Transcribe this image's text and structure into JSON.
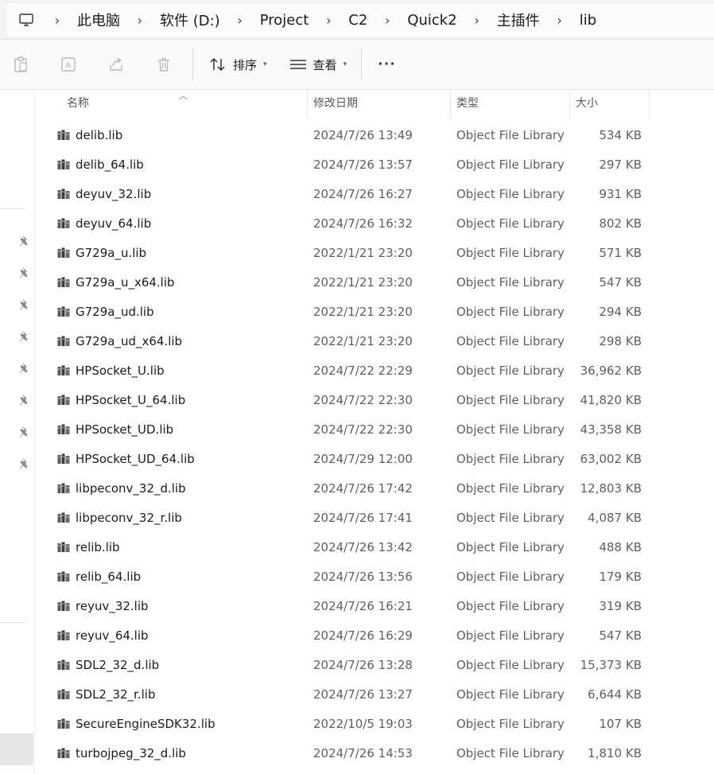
{
  "breadcrumb": {
    "items": [
      "此电脑",
      "软件 (D:)",
      "Project",
      "C2",
      "Quick2",
      "主插件",
      "lib"
    ]
  },
  "toolbar": {
    "sort_label": "排序",
    "view_label": "查看",
    "more_label": "···"
  },
  "columns": {
    "name": "名称",
    "date": "修改日期",
    "type": "类型",
    "size": "大小"
  },
  "files": [
    {
      "name": "delib.lib",
      "date": "2024/7/26 13:49",
      "type": "Object File Library",
      "size": "534 KB"
    },
    {
      "name": "delib_64.lib",
      "date": "2024/7/26 13:57",
      "type": "Object File Library",
      "size": "297 KB"
    },
    {
      "name": "deyuv_32.lib",
      "date": "2024/7/26 16:27",
      "type": "Object File Library",
      "size": "931 KB"
    },
    {
      "name": "deyuv_64.lib",
      "date": "2024/7/26 16:32",
      "type": "Object File Library",
      "size": "802 KB"
    },
    {
      "name": "G729a_u.lib",
      "date": "2022/1/21 23:20",
      "type": "Object File Library",
      "size": "571 KB"
    },
    {
      "name": "G729a_u_x64.lib",
      "date": "2022/1/21 23:20",
      "type": "Object File Library",
      "size": "547 KB"
    },
    {
      "name": "G729a_ud.lib",
      "date": "2022/1/21 23:20",
      "type": "Object File Library",
      "size": "294 KB"
    },
    {
      "name": "G729a_ud_x64.lib",
      "date": "2022/1/21 23:20",
      "type": "Object File Library",
      "size": "298 KB"
    },
    {
      "name": "HPSocket_U.lib",
      "date": "2024/7/22 22:29",
      "type": "Object File Library",
      "size": "36,962 KB"
    },
    {
      "name": "HPSocket_U_64.lib",
      "date": "2024/7/22 22:30",
      "type": "Object File Library",
      "size": "41,820 KB"
    },
    {
      "name": "HPSocket_UD.lib",
      "date": "2024/7/22 22:30",
      "type": "Object File Library",
      "size": "43,358 KB"
    },
    {
      "name": "HPSocket_UD_64.lib",
      "date": "2024/7/29 12:00",
      "type": "Object File Library",
      "size": "63,002 KB"
    },
    {
      "name": "libpeconv_32_d.lib",
      "date": "2024/7/26 17:42",
      "type": "Object File Library",
      "size": "12,803 KB"
    },
    {
      "name": "libpeconv_32_r.lib",
      "date": "2024/7/26 17:41",
      "type": "Object File Library",
      "size": "4,087 KB"
    },
    {
      "name": "relib.lib",
      "date": "2024/7/26 13:42",
      "type": "Object File Library",
      "size": "488 KB"
    },
    {
      "name": "relib_64.lib",
      "date": "2024/7/26 13:56",
      "type": "Object File Library",
      "size": "179 KB"
    },
    {
      "name": "reyuv_32.lib",
      "date": "2024/7/26 16:21",
      "type": "Object File Library",
      "size": "319 KB"
    },
    {
      "name": "reyuv_64.lib",
      "date": "2024/7/26 16:29",
      "type": "Object File Library",
      "size": "547 KB"
    },
    {
      "name": "SDL2_32_d.lib",
      "date": "2024/7/26 13:28",
      "type": "Object File Library",
      "size": "15,373 KB"
    },
    {
      "name": "SDL2_32_r.lib",
      "date": "2024/7/26 13:27",
      "type": "Object File Library",
      "size": "6,644 KB"
    },
    {
      "name": "SecureEngineSDK32.lib",
      "date": "2022/10/5 19:03",
      "type": "Object File Library",
      "size": "107 KB"
    },
    {
      "name": "turbojpeg_32_d.lib",
      "date": "2024/7/26 14:53",
      "type": "Object File Library",
      "size": "1,810 KB"
    }
  ],
  "icons": {
    "file": "lib-file-icon",
    "pin": "pin-icon"
  }
}
